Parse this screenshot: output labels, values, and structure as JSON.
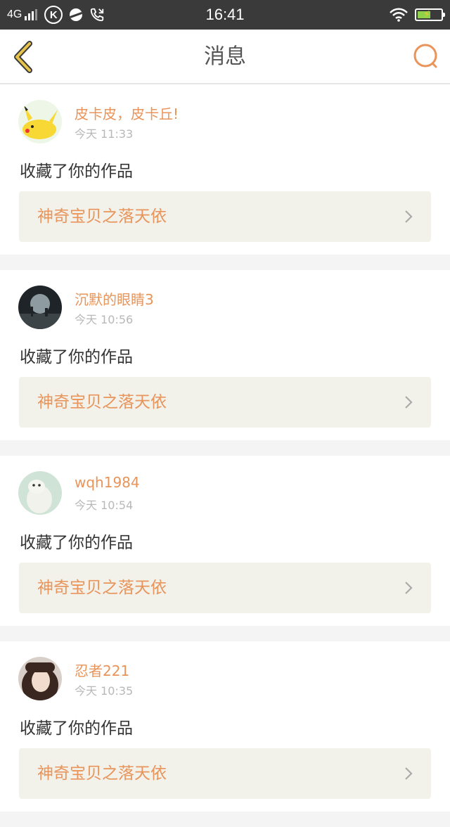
{
  "status_bar": {
    "network": "4G",
    "time": "16:41",
    "k_icon_letter": "K"
  },
  "nav": {
    "title": "消息"
  },
  "colors": {
    "accent": "#e8945a",
    "back_arrow": "#d4b43c",
    "card_link_bg": "#f3f2ea",
    "status_bar_bg": "#3a3a3a"
  },
  "messages": [
    {
      "user": "皮卡皮，皮卡丘!",
      "time": "今天 11:33",
      "action": "收藏了你的作品",
      "work_title": "神奇宝贝之落天依",
      "avatar": "pikachu-avatar"
    },
    {
      "user": "沉默的眼睛3",
      "time": "今天 10:56",
      "action": "收藏了你的作品",
      "work_title": "神奇宝贝之落天依",
      "avatar": "night-scene-avatar"
    },
    {
      "user": "wqh1984",
      "time": "今天 10:54",
      "action": "收藏了你的作品",
      "work_title": "神奇宝贝之落天依",
      "avatar": "ferret-avatar"
    },
    {
      "user": "忍者221",
      "time": "今天 10:35",
      "action": "收藏了你的作品",
      "work_title": "神奇宝贝之落天依",
      "avatar": "girl-portrait-avatar"
    }
  ]
}
